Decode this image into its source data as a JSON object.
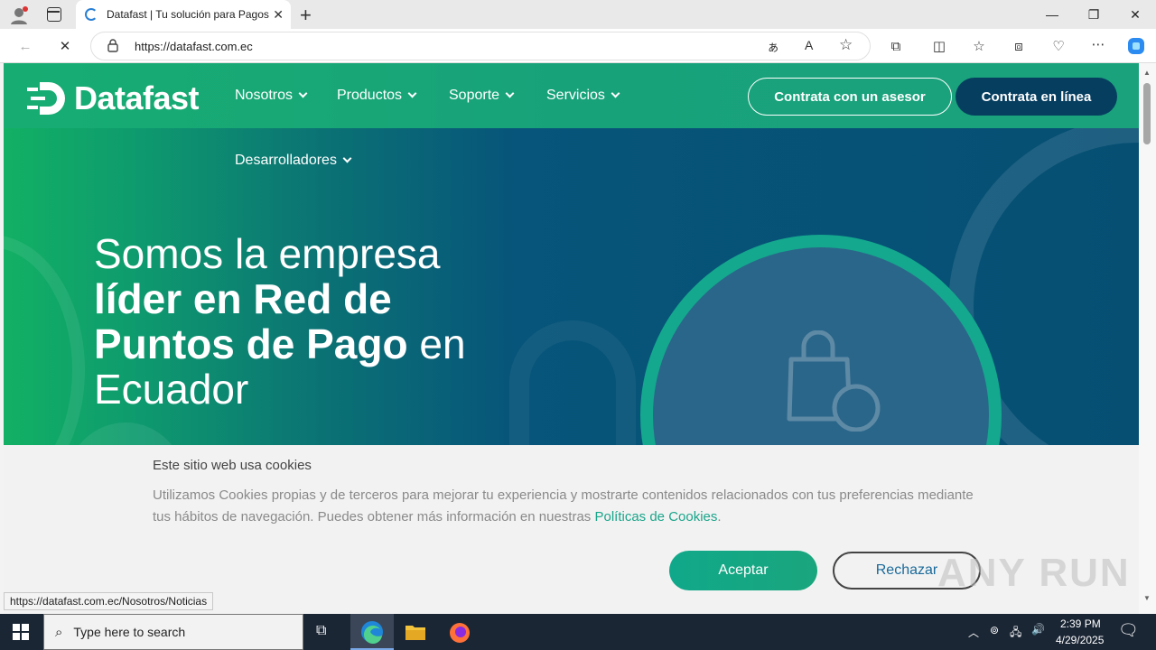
{
  "browser": {
    "tab_title": "Datafast | Tu solución para Pagos",
    "url": "https://datafast.com.ec",
    "status_url": "https://datafast.com.ec/Nosotros/Noticias"
  },
  "site": {
    "logo_text": "Datafast",
    "nav": [
      {
        "label": "Nosotros"
      },
      {
        "label": "Productos"
      },
      {
        "label": "Soporte"
      },
      {
        "label": "Servicios"
      },
      {
        "label": "Desarrolladores"
      }
    ],
    "cta_advisor": "Contrata con un asesor",
    "cta_online": "Contrata en línea",
    "headline": {
      "line1": "Somos la empresa",
      "line2": "líder en Red de",
      "line3_bold": "Puntos de Pago",
      "line3_rest": " en",
      "line4": "Ecuador"
    }
  },
  "cookie": {
    "title": "Este sitio web usa cookies",
    "text": "Utilizamos Cookies propias y de terceros para mejorar tu experiencia y mostrarte contenidos relacionados con tus preferencias mediante tus hábitos de navegación. Puedes obtener más información en nuestras ",
    "link": "Políticas de Cookies",
    "suffix": ".",
    "accept": "Aceptar",
    "reject": "Rechazar"
  },
  "watermark": "ANY RUN",
  "taskbar": {
    "search_placeholder": "Type here to search",
    "time": "2:39 PM",
    "date": "4/29/2025"
  },
  "colors": {
    "nav_green": "#17ad72",
    "hero_blue": "#064f73",
    "dark_button": "#063e60",
    "ring_teal": "#14a88e"
  }
}
